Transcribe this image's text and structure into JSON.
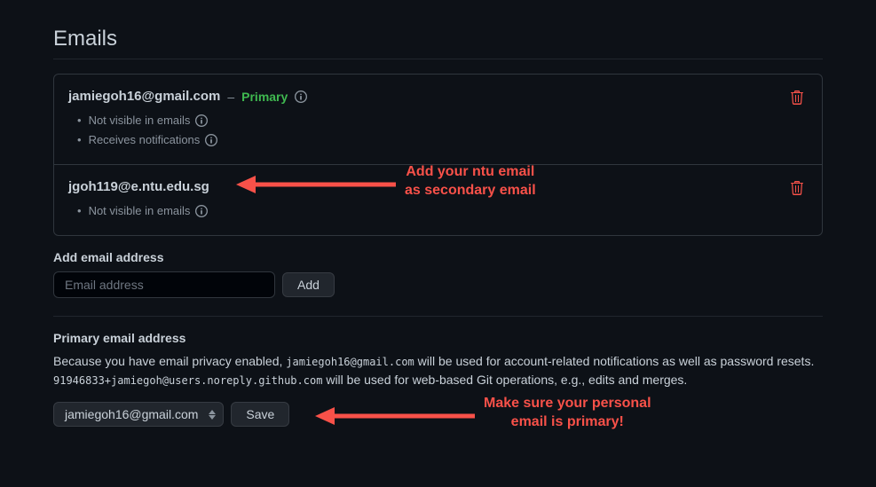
{
  "page": {
    "title": "Emails"
  },
  "emails": [
    {
      "address": "jamiegoh16@gmail.com",
      "primary_label": "Primary",
      "meta": {
        "not_visible": "Not visible in emails",
        "receives_notifications": "Receives notifications"
      }
    },
    {
      "address": "jgoh119@e.ntu.edu.sg",
      "meta": {
        "not_visible": "Not visible in emails"
      }
    }
  ],
  "add_email": {
    "label": "Add email address",
    "placeholder": "Email address",
    "button": "Add"
  },
  "primary_email": {
    "label": "Primary email address",
    "description_prefix": "Because you have email privacy enabled, ",
    "email_code": "jamiegoh16@gmail.com",
    "description_mid": " will be used for account-related notifications as well as password resets. ",
    "noreply_code": "91946833+jamiegoh@users.noreply.github.com",
    "description_suffix": " will be used for web-based Git operations, e.g., edits and merges.",
    "selected": "jamiegoh16@gmail.com",
    "save_button": "Save"
  },
  "annotations": {
    "secondary": "Add your ntu email\nas secondary email",
    "primary": "Make sure your personal\nemail is primary!"
  }
}
